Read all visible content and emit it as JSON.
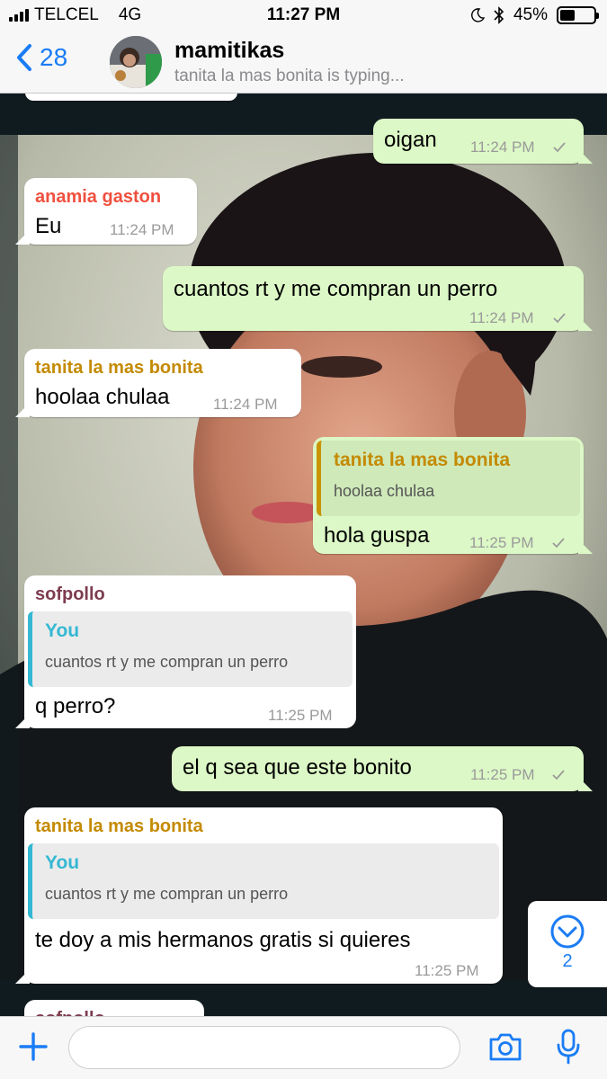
{
  "status_bar": {
    "carrier": "TELCEL",
    "network": "4G",
    "time": "11:27 PM",
    "battery": "45%"
  },
  "header": {
    "back_count": "28",
    "title": "mamitikas",
    "subtitle": "tanita la mas bonita is typing..."
  },
  "messages": [
    {
      "dir": "out",
      "text": "oigan",
      "time": "11:24 PM"
    },
    {
      "dir": "in",
      "sender": "anamia gaston",
      "sender_color": "#f0503f",
      "text": "Eu",
      "time": "11:24 PM"
    },
    {
      "dir": "out",
      "text": "cuantos rt y me compran un perro",
      "time": "11:24 PM"
    },
    {
      "dir": "in",
      "sender": "tanita la mas bonita",
      "sender_color": "#c48a00",
      "text": "hoolaa chulaa",
      "time": "11:24 PM"
    },
    {
      "dir": "out",
      "quote": {
        "name": "tanita la mas bonita",
        "text": "hoolaa chulaa"
      },
      "text": "hola guspa",
      "time": "11:25 PM"
    },
    {
      "dir": "in",
      "sender": "sofpollo",
      "sender_color": "#7d3c4f",
      "quote": {
        "name": "You",
        "text": "cuantos rt y me compran un perro"
      },
      "text": "q perro?",
      "time": "11:25 PM"
    },
    {
      "dir": "out",
      "text": "el q sea que este bonito",
      "time": "11:25 PM"
    },
    {
      "dir": "in",
      "sender": "tanita la mas bonita",
      "sender_color": "#c48a00",
      "quote": {
        "name": "You",
        "text": "cuantos rt y me compran un perro"
      },
      "text": "te doy a mis hermanos gratis si quieres",
      "time": "11:25 PM"
    },
    {
      "dir": "in",
      "sender": "sofpollo",
      "sender_color": "#7d3c4f"
    }
  ],
  "scroll_down": {
    "unread": "2"
  },
  "input": {
    "placeholder": "",
    "value": ""
  },
  "colors": {
    "accent": "#1a7cf5",
    "outgoing": "#dcf8c6",
    "incoming": "#ffffff",
    "quote_you": "#35b8d3",
    "quote_tanita": "#c99400"
  }
}
